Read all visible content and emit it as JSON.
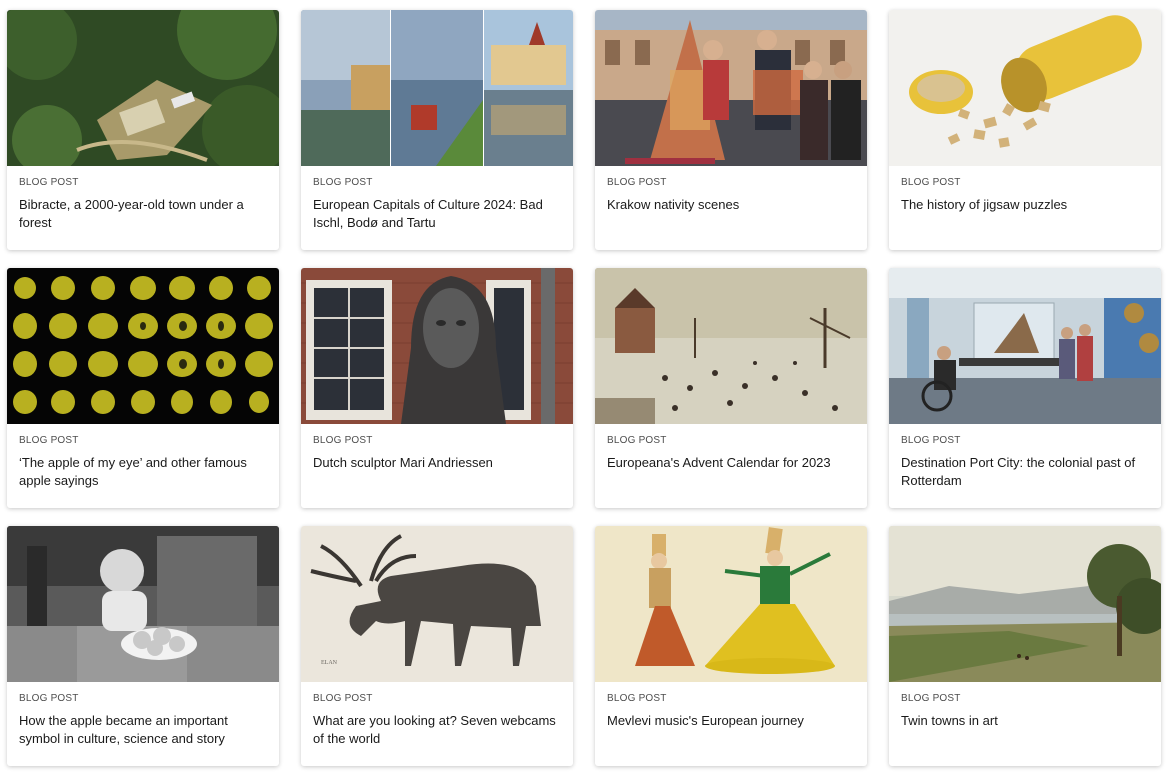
{
  "cards": [
    {
      "label": "BLOG POST",
      "title": "Bibracte, a 2000-year-old town under a forest",
      "image": "aerial-forest-ruins"
    },
    {
      "label": "BLOG POST",
      "title": "European Capitals of Culture 2024: Bad Ischl, Bodø and Tartu",
      "image": "three-town-collage"
    },
    {
      "label": "BLOG POST",
      "title": "Krakow nativity scenes",
      "image": "krakow-nativity-square"
    },
    {
      "label": "BLOG POST",
      "title": "The history of jigsaw puzzles",
      "image": "puzzle-tube"
    },
    {
      "label": "BLOG POST",
      "title": "‘The apple of my eye’ and other famous apple sayings",
      "image": "apple-slices-grid"
    },
    {
      "label": "BLOG POST",
      "title": "Dutch sculptor Mari Andriessen",
      "image": "bronze-bust"
    },
    {
      "label": "BLOG POST",
      "title": "Europeana's Advent Calendar for 2023",
      "image": "winter-landscape-painting"
    },
    {
      "label": "BLOG POST",
      "title": "Destination Port City: the colonial past of Rotterdam",
      "image": "museum-gallery"
    },
    {
      "label": "BLOG POST",
      "title": "How the apple became an important symbol in culture, science and story",
      "image": "child-with-apples"
    },
    {
      "label": "BLOG POST",
      "title": "What are you looking at? Seven webcams of the world",
      "image": "moose-engraving"
    },
    {
      "label": "BLOG POST",
      "title": "Mevlevi music's European journey",
      "image": "whirling-dervishes"
    },
    {
      "label": "BLOG POST",
      "title": "Twin towns in art",
      "image": "lake-landscape-painting"
    }
  ]
}
